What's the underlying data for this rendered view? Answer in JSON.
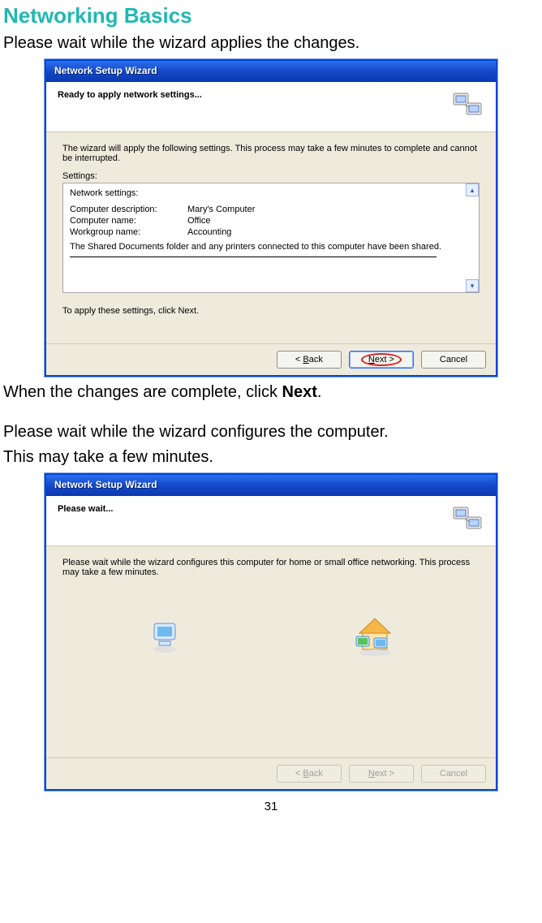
{
  "page": {
    "title": "Networking Basics",
    "intro1": "Please wait while the wizard applies the changes.",
    "mid_line_a": "When the changes are complete, click ",
    "mid_line_b": "Next",
    "mid_line_c": ".",
    "intro2a": "Please wait while the wizard configures the computer.",
    "intro2b": "This may take a few minutes.",
    "pagenum": "31"
  },
  "wizard1": {
    "titlebar": "Network Setup Wizard",
    "header_title": "Ready to apply network settings...",
    "body_line1": "The wizard will apply the following settings. This process may take a few minutes to complete and cannot be interrupted.",
    "settings_label": "Settings:",
    "network_settings": "Network settings:",
    "rows": {
      "desc_k": "Computer description:",
      "desc_v": "Mary's Computer",
      "name_k": "Computer name:",
      "name_v": "Office",
      "wg_k": "Workgroup name:",
      "wg_v": "Accounting"
    },
    "shared_line": "The Shared Documents folder and any printers connected to this computer have been shared.",
    "apply_line": "To apply these settings, click Next.",
    "buttons": {
      "back_pre": "< ",
      "back_u": "B",
      "back_post": "ack",
      "next_u": "N",
      "next_post": "ext >",
      "cancel": "Cancel"
    }
  },
  "wizard2": {
    "titlebar": "Network Setup Wizard",
    "header_title": "Please wait...",
    "body_line1": "Please wait while the wizard configures this computer for home or small office networking. This process may take a few minutes.",
    "buttons": {
      "back_pre": "< ",
      "back_u": "B",
      "back_post": "ack",
      "next_u": "N",
      "next_post": "ext >",
      "cancel": "Cancel"
    }
  }
}
